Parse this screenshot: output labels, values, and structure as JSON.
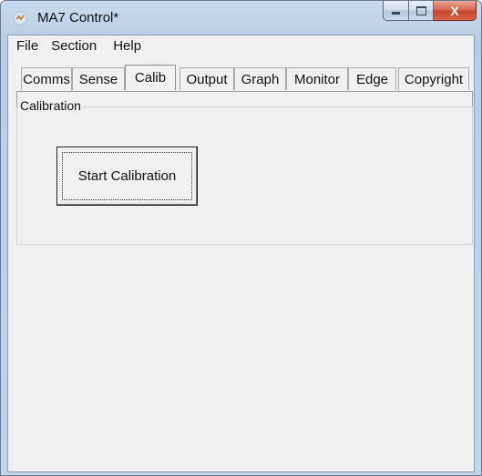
{
  "window": {
    "title": "MA7 Control*"
  },
  "caption_buttons": {
    "minimize_icon": "minimize-icon",
    "maximize_icon": "maximize-icon",
    "close_icon": "close-icon",
    "close_glyph": "X"
  },
  "menu": [
    "File",
    "Section",
    "Help"
  ],
  "tabs": [
    "Comms",
    "Sense",
    "Calib",
    "Output",
    "Graph",
    "Monitor",
    "Edge",
    "Copyright"
  ],
  "active_tab": "Calib",
  "calibration": {
    "group_label": "Calibration",
    "start_button": "Start Calibration"
  }
}
